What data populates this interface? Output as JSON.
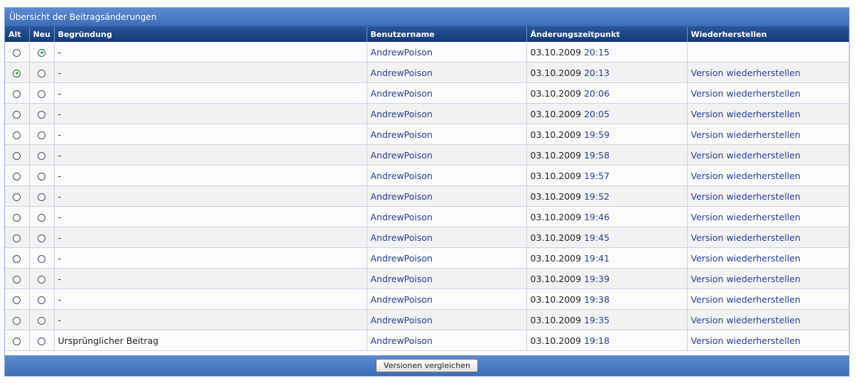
{
  "panel": {
    "title": "Übersicht der Beitragsänderungen"
  },
  "columns": {
    "old": "Alt",
    "new": "Neu",
    "reason": "Begründung",
    "username": "Benutzername",
    "changed_at": "Änderungszeitpunkt",
    "restore": "Wiederherstellen"
  },
  "rows": [
    {
      "old_checked": false,
      "new_checked": true,
      "reason": "-",
      "user": "AndrewPoison",
      "date": "03.10.2009",
      "time": "20:15",
      "restore": ""
    },
    {
      "old_checked": true,
      "new_checked": false,
      "reason": "-",
      "user": "AndrewPoison",
      "date": "03.10.2009",
      "time": "20:13",
      "restore": "Version wiederherstellen"
    },
    {
      "old_checked": false,
      "new_checked": false,
      "reason": "-",
      "user": "AndrewPoison",
      "date": "03.10.2009",
      "time": "20:06",
      "restore": "Version wiederherstellen"
    },
    {
      "old_checked": false,
      "new_checked": false,
      "reason": "-",
      "user": "AndrewPoison",
      "date": "03.10.2009",
      "time": "20:05",
      "restore": "Version wiederherstellen"
    },
    {
      "old_checked": false,
      "new_checked": false,
      "reason": "-",
      "user": "AndrewPoison",
      "date": "03.10.2009",
      "time": "19:59",
      "restore": "Version wiederherstellen"
    },
    {
      "old_checked": false,
      "new_checked": false,
      "reason": "-",
      "user": "AndrewPoison",
      "date": "03.10.2009",
      "time": "19:58",
      "restore": "Version wiederherstellen"
    },
    {
      "old_checked": false,
      "new_checked": false,
      "reason": "-",
      "user": "AndrewPoison",
      "date": "03.10.2009",
      "time": "19:57",
      "restore": "Version wiederherstellen"
    },
    {
      "old_checked": false,
      "new_checked": false,
      "reason": "-",
      "user": "AndrewPoison",
      "date": "03.10.2009",
      "time": "19:52",
      "restore": "Version wiederherstellen"
    },
    {
      "old_checked": false,
      "new_checked": false,
      "reason": "-",
      "user": "AndrewPoison",
      "date": "03.10.2009",
      "time": "19:46",
      "restore": "Version wiederherstellen"
    },
    {
      "old_checked": false,
      "new_checked": false,
      "reason": "-",
      "user": "AndrewPoison",
      "date": "03.10.2009",
      "time": "19:45",
      "restore": "Version wiederherstellen"
    },
    {
      "old_checked": false,
      "new_checked": false,
      "reason": "-",
      "user": "AndrewPoison",
      "date": "03.10.2009",
      "time": "19:41",
      "restore": "Version wiederherstellen"
    },
    {
      "old_checked": false,
      "new_checked": false,
      "reason": "-",
      "user": "AndrewPoison",
      "date": "03.10.2009",
      "time": "19:39",
      "restore": "Version wiederherstellen"
    },
    {
      "old_checked": false,
      "new_checked": false,
      "reason": "-",
      "user": "AndrewPoison",
      "date": "03.10.2009",
      "time": "19:38",
      "restore": "Version wiederherstellen"
    },
    {
      "old_checked": false,
      "new_checked": false,
      "reason": "-",
      "user": "AndrewPoison",
      "date": "03.10.2009",
      "time": "19:35",
      "restore": "Version wiederherstellen"
    },
    {
      "old_checked": false,
      "new_checked": false,
      "reason": "Ursprünglicher Beitrag",
      "user": "AndrewPoison",
      "date": "03.10.2009",
      "time": "19:18",
      "restore": "Version wiederherstellen"
    }
  ],
  "footer": {
    "compare_label": "Versionen vergleichen"
  }
}
